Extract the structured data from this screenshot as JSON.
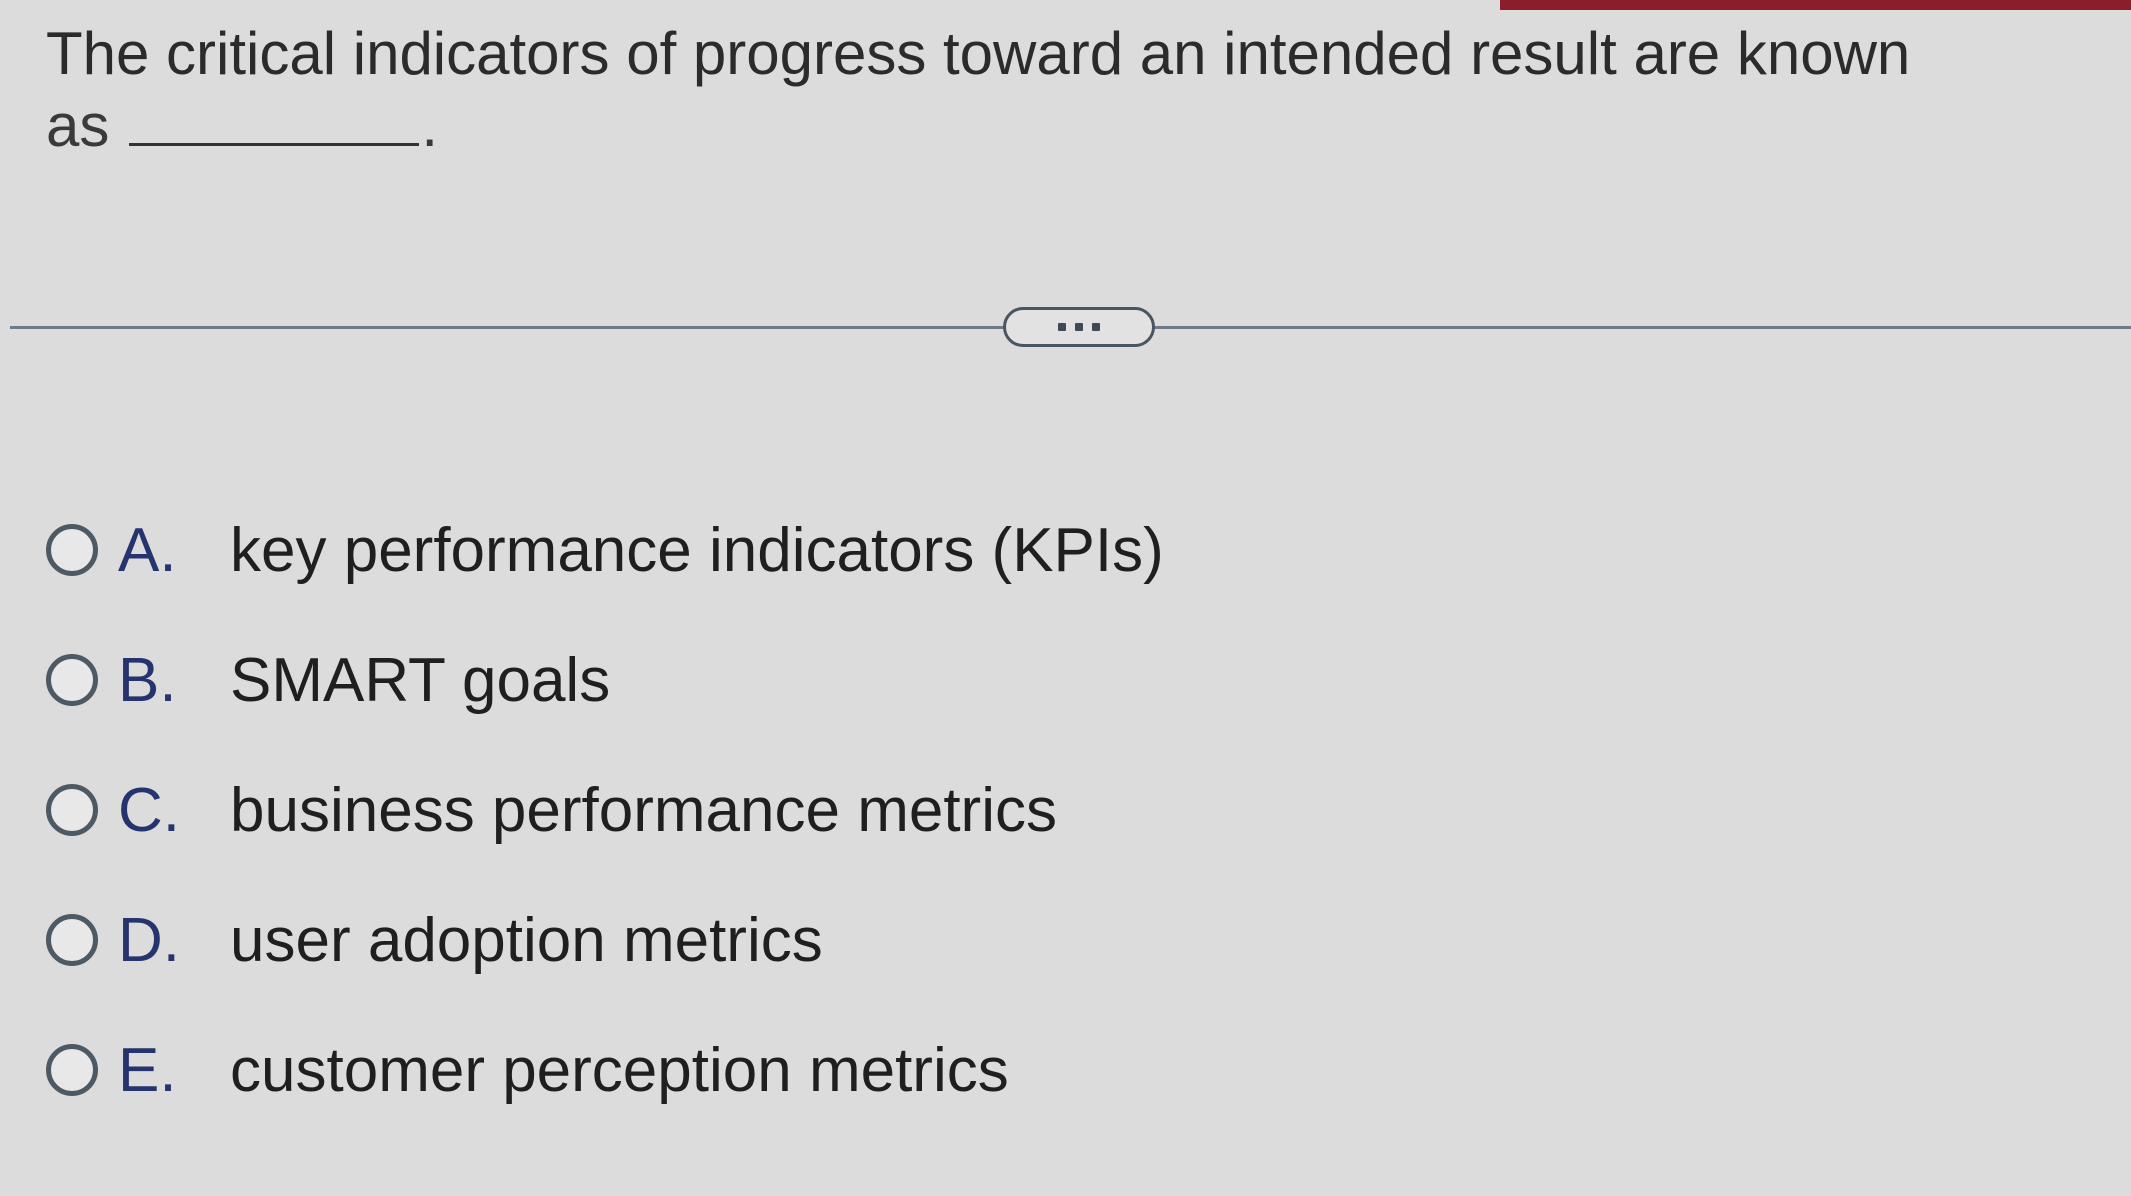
{
  "question": {
    "line1": "The critical indicators of progress toward an intended result are known",
    "line2_prefix": "as",
    "line2_suffix": "."
  },
  "more_button": {
    "icon": "ellipsis-icon"
  },
  "options": [
    {
      "letter": "A.",
      "text": "key performance indicators (KPIs)"
    },
    {
      "letter": "B.",
      "text": "SMART goals"
    },
    {
      "letter": "C.",
      "text": "business performance metrics"
    },
    {
      "letter": "D.",
      "text": "user adoption metrics"
    },
    {
      "letter": "E.",
      "text": "customer perception metrics"
    }
  ],
  "colors": {
    "background": "#dcdcdc",
    "top_accent": "#8c1d2a",
    "option_letter": "#25336e",
    "divider": "#6e7a86"
  }
}
